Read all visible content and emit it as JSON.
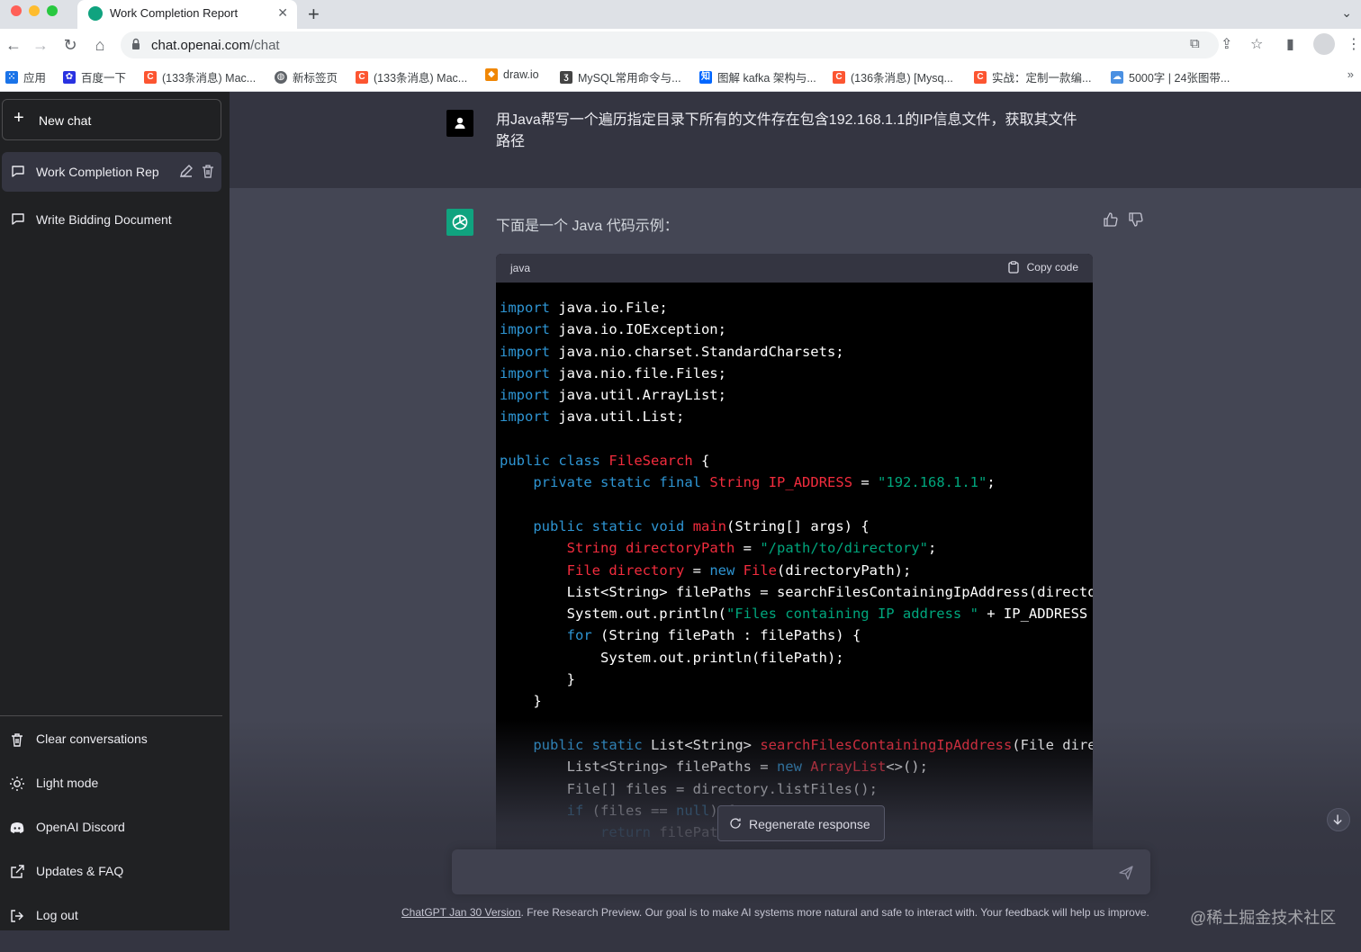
{
  "browser": {
    "tab_title": "Work Completion Report",
    "url_host": "chat.openai.com",
    "url_path": "/chat",
    "bookmarks": [
      {
        "label": "应用",
        "icon": "apps-grid-icon",
        "color": "#1a73e8"
      },
      {
        "label": "百度一下",
        "icon": "baidu-paw-icon",
        "color": "#2932e1"
      },
      {
        "label": "(133条消息) Mac...",
        "icon": "csdn-c-icon",
        "color": "#fc5531"
      },
      {
        "label": "新标签页",
        "icon": "globe-icon",
        "color": "#5f6368"
      },
      {
        "label": "(133条消息) Mac...",
        "icon": "csdn-c-icon",
        "color": "#fc5531"
      },
      {
        "label": "draw.io",
        "icon": "drawio-icon",
        "color": "#f08705"
      },
      {
        "label": "MySQL常用命令与...",
        "icon": "mysql-icon",
        "color": "#444444"
      },
      {
        "label": "图解 kafka 架构与...",
        "icon": "zhihu-icon",
        "color": "#0066ff"
      },
      {
        "label": "(136条消息) [Mysq...",
        "icon": "csdn-c-icon",
        "color": "#fc5531"
      },
      {
        "label": "实战：定制一款编...",
        "icon": "csdn-c-icon",
        "color": "#fc5531"
      },
      {
        "label": "5000字 | 24张图带...",
        "icon": "cloud-icon",
        "color": "#4a90e2"
      }
    ],
    "bookmarks_more": "»"
  },
  "sidebar": {
    "new_chat": "New chat",
    "conversations": [
      {
        "label": "Work Completion Rep",
        "active": true
      },
      {
        "label": "Write Bidding Document",
        "active": false
      }
    ],
    "bottom": [
      {
        "label": "Clear conversations",
        "icon": "trash-icon"
      },
      {
        "label": "Light mode",
        "icon": "sun-icon"
      },
      {
        "label": "OpenAI Discord",
        "icon": "discord-icon"
      },
      {
        "label": "Updates & FAQ",
        "icon": "external-link-icon"
      },
      {
        "label": "Log out",
        "icon": "logout-icon"
      }
    ]
  },
  "chat": {
    "user_message": "用Java帮写一个遍历指定目录下所有的文件存在包含192.168.1.1的IP信息文件，获取其文件路径",
    "assistant_intro": "下面是一个 Java 代码示例：",
    "code_language": "java",
    "copy_label": "Copy code",
    "code_lines": [
      [
        [
          "k",
          "import"
        ],
        [
          "p",
          " java.io.File;"
        ]
      ],
      [
        [
          "k",
          "import"
        ],
        [
          "p",
          " java.io.IOException;"
        ]
      ],
      [
        [
          "k",
          "import"
        ],
        [
          "p",
          " java.nio.charset.StandardCharsets;"
        ]
      ],
      [
        [
          "k",
          "import"
        ],
        [
          "p",
          " java.nio.file.Files;"
        ]
      ],
      [
        [
          "k",
          "import"
        ],
        [
          "p",
          " java.util.ArrayList;"
        ]
      ],
      [
        [
          "k",
          "import"
        ],
        [
          "p",
          " java.util.List;"
        ]
      ],
      [],
      [
        [
          "k",
          "public"
        ],
        [
          "p",
          " "
        ],
        [
          "k",
          "class"
        ],
        [
          "p",
          " "
        ],
        [
          "t",
          "FileSearch"
        ],
        [
          "p",
          " {"
        ]
      ],
      [
        [
          "p",
          "    "
        ],
        [
          "k",
          "private"
        ],
        [
          "p",
          " "
        ],
        [
          "k",
          "static"
        ],
        [
          "p",
          " "
        ],
        [
          "k",
          "final"
        ],
        [
          "p",
          " "
        ],
        [
          "t",
          "String"
        ],
        [
          "p",
          " "
        ],
        [
          "t",
          "IP_ADDRESS"
        ],
        [
          "p",
          " = "
        ],
        [
          "s",
          "\"192.168.1.1\""
        ],
        [
          "p",
          ";"
        ]
      ],
      [],
      [
        [
          "p",
          "    "
        ],
        [
          "k",
          "public"
        ],
        [
          "p",
          " "
        ],
        [
          "k",
          "static"
        ],
        [
          "p",
          " "
        ],
        [
          "k",
          "void"
        ],
        [
          "p",
          " "
        ],
        [
          "t",
          "main"
        ],
        [
          "p",
          "(String[] args) {"
        ]
      ],
      [
        [
          "p",
          "        "
        ],
        [
          "t",
          "String"
        ],
        [
          "p",
          " "
        ],
        [
          "t",
          "directoryPath"
        ],
        [
          "p",
          " = "
        ],
        [
          "s",
          "\"/path/to/directory\""
        ],
        [
          "p",
          ";"
        ]
      ],
      [
        [
          "p",
          "        "
        ],
        [
          "t",
          "File"
        ],
        [
          "p",
          " "
        ],
        [
          "t",
          "directory"
        ],
        [
          "p",
          " = "
        ],
        [
          "k",
          "new"
        ],
        [
          "p",
          " "
        ],
        [
          "t",
          "File"
        ],
        [
          "p",
          "(directoryPath);"
        ]
      ],
      [
        [
          "p",
          "        List<String> filePaths = searchFilesContainingIpAddress(directory, IP_"
        ]
      ],
      [
        [
          "p",
          "        System.out.println("
        ],
        [
          "s",
          "\"Files containing IP address \""
        ],
        [
          "p",
          " + IP_ADDRESS + "
        ],
        [
          "s",
          "\":\""
        ],
        [
          "p",
          ")"
        ]
      ],
      [
        [
          "p",
          "        "
        ],
        [
          "k",
          "for"
        ],
        [
          "p",
          " (String filePath : filePaths) {"
        ]
      ],
      [
        [
          "p",
          "            System.out.println(filePath);"
        ]
      ],
      [
        [
          "p",
          "        }"
        ]
      ],
      [
        [
          "p",
          "    }"
        ]
      ],
      [],
      [
        [
          "p",
          "    "
        ],
        [
          "k",
          "public"
        ],
        [
          "p",
          " "
        ],
        [
          "k",
          "static"
        ],
        [
          "p",
          " List<String> "
        ],
        [
          "t",
          "searchFilesContainingIpAddress"
        ],
        [
          "p",
          "(File directory, "
        ]
      ],
      [
        [
          "p",
          "        List<String> filePaths = "
        ],
        [
          "k",
          "new"
        ],
        [
          "p",
          " "
        ],
        [
          "t",
          "ArrayList"
        ],
        [
          "p",
          "<>();"
        ]
      ],
      [
        [
          "p",
          "        File[] files = directory.listFiles();"
        ]
      ],
      [
        [
          "p",
          "        "
        ],
        [
          "k",
          "if"
        ],
        [
          "p",
          " (files == "
        ],
        [
          "k",
          "null"
        ],
        [
          "p",
          ") {"
        ]
      ],
      [
        [
          "p",
          "            "
        ],
        [
          "k",
          "return"
        ],
        [
          "p",
          " filePaths"
        ]
      ]
    ],
    "regenerate_label": "Regenerate response",
    "input_placeholder": ""
  },
  "footer": {
    "version_link": "ChatGPT Jan 30 Version",
    "text": ". Free Research Preview. Our goal is to make AI systems more natural and safe to interact with. Your feedback will help us improve."
  },
  "watermark": "@稀土掘金技术社区",
  "colors": {
    "sidebar_bg": "#202123",
    "main_bg": "#343541",
    "assistant_bg": "#444654",
    "openai_green": "#10a37f",
    "code_keyword": "#2e95d3",
    "code_title": "#f22c3d",
    "code_string": "#00a67d"
  }
}
